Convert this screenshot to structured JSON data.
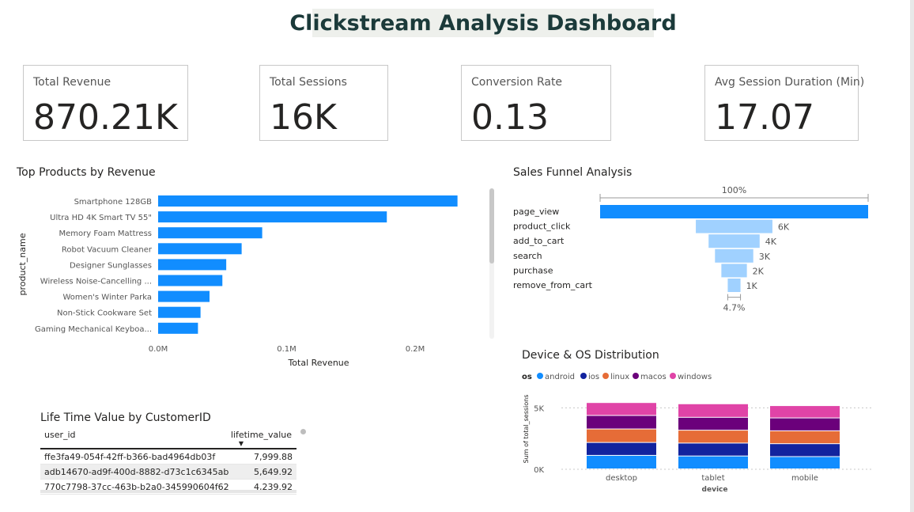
{
  "title": "Clickstream Analysis Dashboard",
  "kpis": [
    {
      "label": "Total Revenue",
      "value": "870.21K"
    },
    {
      "label": "Total Sessions",
      "value": "16K"
    },
    {
      "label": "Conversion Rate",
      "value": "0.13"
    },
    {
      "label": "Avg Session Duration (Min)",
      "value": "17.07"
    }
  ],
  "top_products": {
    "title": "Top Products by Revenue",
    "ylabel": "product_name",
    "xlabel": "Total Revenue",
    "x_ticks": [
      "0.0M",
      "0.1M",
      "0.2M"
    ],
    "color": "#118dff"
  },
  "funnel": {
    "title": "Sales Funnel Analysis",
    "top_pct": "100%",
    "bottom_pct": "4.7%",
    "main_color": "#118dff",
    "light_color": "#a0d1ff"
  },
  "device": {
    "title": "Device & OS Distribution",
    "legend_title": "os",
    "ylabel": "Sum of total_sessions",
    "xlabel": "device",
    "y_ticks": [
      "5K",
      "0K"
    ]
  },
  "ltv": {
    "title": "Life Time Value by CustomerID",
    "col_user": "user_id",
    "col_value": "lifetime_value",
    "rows": [
      {
        "user_id": "ffe3fa49-054f-42ff-b366-bad4964db03f",
        "value": "7,999.88"
      },
      {
        "user_id": "adb14670-ad9f-400d-8882-d73c1c6345ab",
        "value": "5,649.92"
      },
      {
        "user_id": "770c7798-37cc-463b-b2a0-345990604f62",
        "value": "4,239.92"
      }
    ]
  },
  "chart_data": [
    {
      "type": "bar",
      "orientation": "horizontal",
      "title": "Top Products by Revenue",
      "xlabel": "Total Revenue",
      "ylabel": "product_name",
      "categories": [
        "Smartphone 128GB",
        "Ultra HD 4K Smart TV 55\"",
        "Memory Foam Mattress",
        "Robot Vacuum Cleaner",
        "Designer Sunglasses",
        "Wireless Noise-Cancelling ...",
        "Women's Winter Parka",
        "Non-Stick Cookware Set",
        "Gaming Mechanical Keyboa..."
      ],
      "values": [
        0.233,
        0.178,
        0.081,
        0.065,
        0.053,
        0.05,
        0.04,
        0.033,
        0.031
      ],
      "xlim": [
        0,
        0.26
      ],
      "unit": "M"
    },
    {
      "type": "bar",
      "subtype": "funnel",
      "title": "Sales Funnel Analysis",
      "categories": [
        "page_view",
        "product_click",
        "add_to_cart",
        "search",
        "purchase",
        "remove_from_cart"
      ],
      "values": [
        21000,
        6000,
        4000,
        3000,
        2000,
        1000
      ],
      "labels": [
        "",
        "6K",
        "4K",
        "3K",
        "2K",
        "1K"
      ]
    },
    {
      "type": "bar",
      "subtype": "stacked",
      "title": "Device & OS Distribution",
      "xlabel": "device",
      "ylabel": "Sum of total_sessions",
      "categories": [
        "desktop",
        "tablet",
        "mobile"
      ],
      "series": [
        {
          "name": "android",
          "color": "#118dff",
          "values": [
            1100,
            1050,
            1000
          ]
        },
        {
          "name": "ios",
          "color": "#12239e",
          "values": [
            1050,
            1050,
            1050
          ]
        },
        {
          "name": "linux",
          "color": "#e66c37",
          "values": [
            1100,
            1050,
            1050
          ]
        },
        {
          "name": "macos",
          "color": "#6b007b",
          "values": [
            1100,
            1050,
            1050
          ]
        },
        {
          "name": "windows",
          "color": "#e044a7",
          "values": [
            1050,
            1100,
            1000
          ]
        }
      ],
      "ylim": [
        0,
        5800
      ]
    }
  ]
}
